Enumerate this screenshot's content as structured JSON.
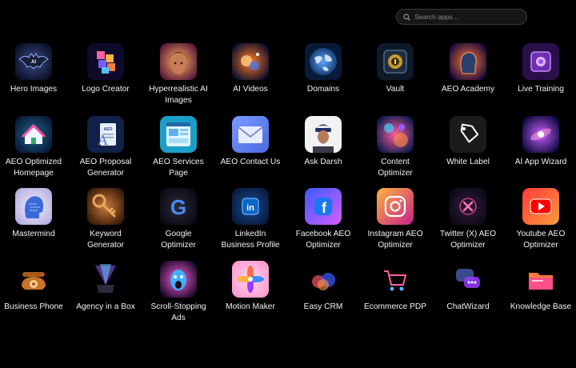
{
  "search": {
    "placeholder": "Search apps..."
  },
  "apps": [
    {
      "label": "Hero Images",
      "icon": "batman-logo-icon"
    },
    {
      "label": "Logo Creator",
      "icon": "colorful-cubes-icon"
    },
    {
      "label": "Hyperrealistic AI\nImages",
      "icon": "woman-portrait-icon"
    },
    {
      "label": "AI Videos",
      "icon": "cosmic-explosion-icon"
    },
    {
      "label": "Domains",
      "icon": "globe-icon"
    },
    {
      "label": "Vault",
      "icon": "vault-door-icon"
    },
    {
      "label": "AEO Academy",
      "icon": "ai-head-icon"
    },
    {
      "label": "Live Training",
      "icon": "purple-chip-icon"
    },
    {
      "label": "AEO Optimized\nHomepage",
      "icon": "house-icon"
    },
    {
      "label": "AEO Proposal\nGenerator",
      "icon": "document-pen-icon"
    },
    {
      "label": "AEO Services\nPage",
      "icon": "webpage-layout-icon"
    },
    {
      "label": "AEO Contact Us",
      "icon": "envelope-icon"
    },
    {
      "label": "Ask Darsh",
      "icon": "person-photo-icon"
    },
    {
      "label": "Content\nOptimizer",
      "icon": "content-swirl-icon"
    },
    {
      "label": "White Label",
      "icon": "tag-icon"
    },
    {
      "label": "AI App Wizard",
      "icon": "galaxy-icon"
    },
    {
      "label": "Mastermind",
      "icon": "brain-head-icon"
    },
    {
      "label": "Keyword\nGenerator",
      "icon": "key-icon"
    },
    {
      "label": "Google\nOptimizer",
      "icon": "google-logo-icon"
    },
    {
      "label": "LinkedIn\nBusiness Profile",
      "icon": "linkedin-logo-icon"
    },
    {
      "label": "Facebook AEO\nOptimizer",
      "icon": "facebook-logo-icon"
    },
    {
      "label": "Instagram AEO\nOptimizer",
      "icon": "instagram-logo-icon"
    },
    {
      "label": "Twitter (X) AEO\nOptimizer",
      "icon": "x-logo-icon"
    },
    {
      "label": "Youtube AEO\nOptimizer",
      "icon": "youtube-logo-icon"
    },
    {
      "label": "Business Phone",
      "icon": "rotary-phone-icon"
    },
    {
      "label": "Agency in a Box",
      "icon": "light-box-icon"
    },
    {
      "label": "Scroll-Stopping\nAds",
      "icon": "shouting-face-icon"
    },
    {
      "label": "Motion Maker",
      "icon": "motion-petals-icon"
    },
    {
      "label": "Easy CRM",
      "icon": "data-cloud-icon"
    },
    {
      "label": "Ecommerce PDP",
      "icon": "shopping-cart-icon"
    },
    {
      "label": "ChatWizard",
      "icon": "chat-bubbles-icon"
    },
    {
      "label": "Knowledge Base",
      "icon": "folder-icon"
    }
  ]
}
